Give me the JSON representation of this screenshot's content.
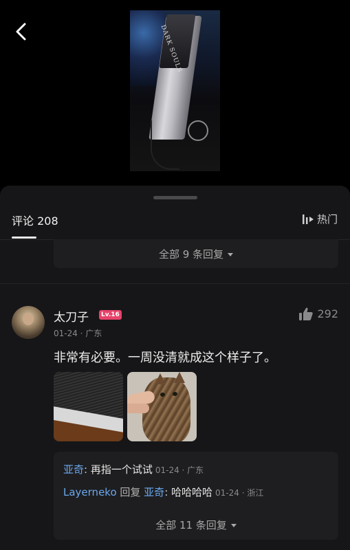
{
  "header": {
    "back_icon": "chevron-left-icon"
  },
  "video": {
    "thumb_text": "DARK SOULS"
  },
  "comments_panel": {
    "tab_label": "评论 208",
    "sort_label": "热门",
    "sort_icon": "sort-bars-icon",
    "first_thread_more": "全部 9 条回复"
  },
  "comment": {
    "username": "太刀子",
    "level": "Lv.16",
    "level_color": "#e6426a",
    "meta": "01-24 · 广东",
    "likes": "292",
    "like_icon": "thumbs-up-icon",
    "text": "非常有必要。一周没清就成这个样子了。",
    "images": [
      {
        "alt": "dusty-console-vent-photo"
      },
      {
        "alt": "cat-photo"
      }
    ],
    "replies": [
      {
        "author": "亚奇",
        "sep": ": ",
        "text": "再指一个试试",
        "time": "01-24 · 广东"
      },
      {
        "author": "Layerneko",
        "reply_word": " 回复 ",
        "reply_to": "亚奇",
        "sep": ": ",
        "text": "哈哈哈哈",
        "time": "01-24 · 浙江"
      }
    ],
    "more_replies": "全部 11 条回复"
  },
  "colors": {
    "background": "#000000",
    "sheet": "#161618",
    "reply_box": "#1e1e20",
    "link_blue": "#6aa8ee"
  }
}
